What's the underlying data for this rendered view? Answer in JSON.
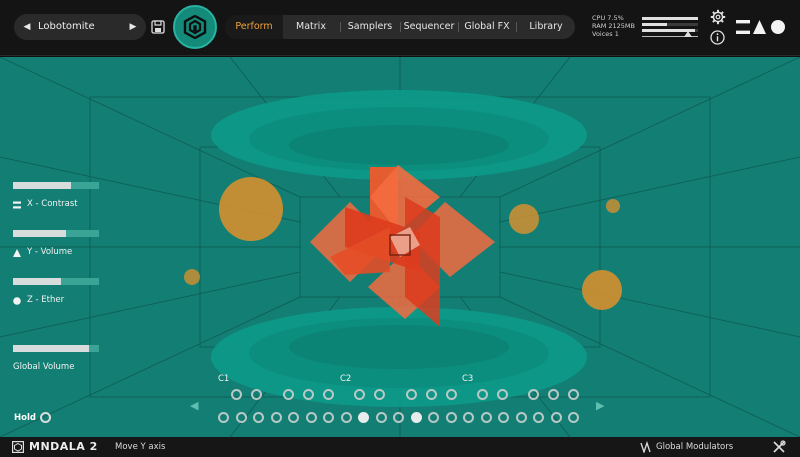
{
  "preset": {
    "name": "Lobotomite",
    "prev": "◀",
    "next": "▶"
  },
  "nav": {
    "tabs": [
      "Perform",
      "Matrix",
      "Samplers",
      "Sequencer",
      "Global FX",
      "Library"
    ],
    "active": 0
  },
  "stats": {
    "cpu": "CPU 7.5%",
    "ram": "RAM 2125MB",
    "voices": "Voices 1"
  },
  "meter": {
    "levels": [
      1.0,
      0.45,
      0.95
    ]
  },
  "controls": [
    {
      "label": "X - Contrast",
      "value": 0.67,
      "icon": "square-icon"
    },
    {
      "label": "Y - Volume",
      "value": 0.62,
      "icon": "triangle-icon"
    },
    {
      "label": "Z - Ether",
      "value": 0.56,
      "icon": "circle-icon"
    },
    {
      "label": "Global Volume",
      "value": 0.88,
      "icon": ""
    }
  ],
  "hold": {
    "label": "Hold"
  },
  "keyboard": {
    "octaves": [
      "C1",
      "C2",
      "C3"
    ],
    "arrow_left": "◀",
    "arrow_right": "▶",
    "upper_active": [],
    "lower_active": [
      8,
      11
    ]
  },
  "footer": {
    "title": "MNDALA 2",
    "status": "Move Y axis",
    "modulators": "Global Modulators"
  },
  "colors": {
    "teal": "#137f74",
    "accent": "#f0a23a",
    "shape": "#f0401c",
    "orb": "#e0912c"
  }
}
